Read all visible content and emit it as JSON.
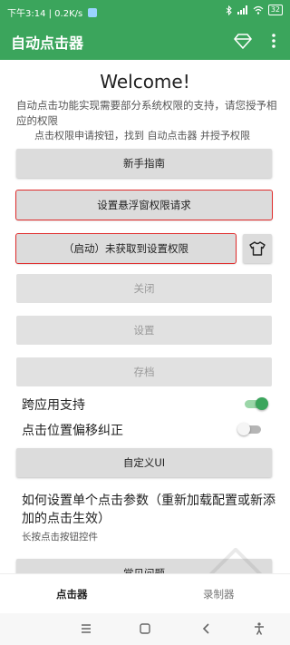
{
  "status_bar": {
    "time_speed": "下午3:14 | 0.2K/s",
    "battery": "32"
  },
  "app_bar": {
    "title": "自动点击器",
    "icons": [
      "diamond-icon",
      "more-vert-icon"
    ]
  },
  "main": {
    "welcome": "Welcome!",
    "description": "自动点击功能实现需要部分系统权限的支持，请您授予相应的权限",
    "permission_hint": "点击权限申请按钮，找到 自动点击器 并授予权限",
    "buttons": {
      "guide": "新手指南",
      "overlay_permission": "设置悬浮窗权限请求",
      "start": "（启动）未获取到设置权限",
      "close": "关闭",
      "settings": "设置",
      "archive": "存档",
      "custom_ui": "自定义UI",
      "faq": "常见问题"
    },
    "toggles": {
      "cross_app": {
        "label": "跨应用支持",
        "on": true
      },
      "offset_fix": {
        "label": "点击位置偏移纠正",
        "on": false
      }
    },
    "howto": {
      "title": "如何设置单个点击参数（重新加载配置或新添加的点击生效）",
      "subtitle": "长按点击按钮控件"
    }
  },
  "bottom_tabs": {
    "clicker": "点击器",
    "recorder": "录制器"
  },
  "colors": {
    "accent": "#3ba55c",
    "highlight_box": "#e02b2b"
  }
}
